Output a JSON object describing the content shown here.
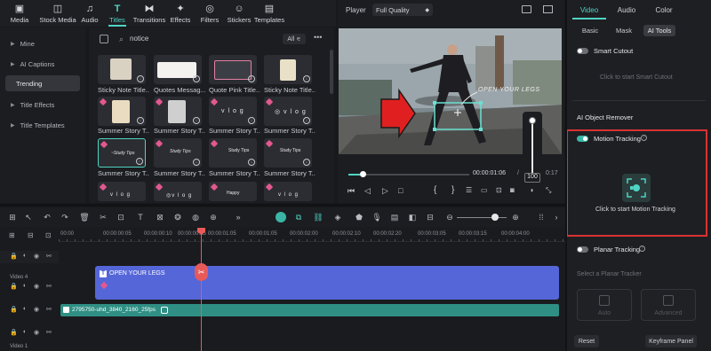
{
  "toolbar": {
    "items": [
      {
        "label": "Media",
        "icon": "media-icon"
      },
      {
        "label": "Stock Media",
        "icon": "stock-media-icon"
      },
      {
        "label": "Audio",
        "icon": "audio-icon"
      },
      {
        "label": "Titles",
        "icon": "titles-icon"
      },
      {
        "label": "Transitions",
        "icon": "transitions-icon"
      },
      {
        "label": "Effects",
        "icon": "effects-icon"
      },
      {
        "label": "Filters",
        "icon": "filters-icon"
      },
      {
        "label": "Stickers",
        "icon": "stickers-icon"
      },
      {
        "label": "Templates",
        "icon": "templates-icon"
      }
    ],
    "active": "Titles"
  },
  "categories": [
    {
      "label": "Mine",
      "selected": false
    },
    {
      "label": "AI Captions",
      "selected": false
    },
    {
      "label": "Trending",
      "selected": true
    },
    {
      "label": "Title Effects",
      "selected": false
    },
    {
      "label": "Title Templates",
      "selected": false
    }
  ],
  "search": {
    "value": "notice",
    "filter_label": "All"
  },
  "assets": [
    {
      "label": "Sticky Note Title..."
    },
    {
      "label": "Quotes Messag..."
    },
    {
      "label": "Quote Pink Title..."
    },
    {
      "label": "Sticky Note Title..."
    },
    {
      "label": "Summer Story T..."
    },
    {
      "label": "Summer Story T..."
    },
    {
      "label": "Summer Story T..."
    },
    {
      "label": "Summer Story T..."
    },
    {
      "label": "Summer Story T..."
    },
    {
      "label": "Summer Story T..."
    },
    {
      "label": "Summer Story T..."
    },
    {
      "label": "Summer Story T..."
    }
  ],
  "player": {
    "label": "Player",
    "quality": "Full Quality",
    "overlay_text": "OPEN YOUR LEGS",
    "timecode": "00:00:01:06",
    "duration_suffix": "0:17",
    "volume": "100",
    "progress": 0.12
  },
  "inspector": {
    "tabs": [
      "Video",
      "Audio",
      "Color"
    ],
    "active_tab": "Video",
    "subtabs": [
      "Basic",
      "Mask",
      "AI Tools"
    ],
    "active_subtab": "AI Tools",
    "smart_cutout": {
      "label": "Smart Cutout",
      "hint": "Click to start Smart Cutout"
    },
    "object_remover": "AI Object Remover",
    "motion_tracking": {
      "label": "Motion Tracking",
      "hint": "Click to start Motion Tracking",
      "enabled": true
    },
    "planar_tracking": {
      "label": "Planar Tracking",
      "select_hint": "Select a Planar Tracker",
      "auto": "Auto",
      "advanced": "Advanced"
    },
    "reset": "Reset",
    "keyframe_panel": "Keyframe Panel",
    "highlight_color": "#d93232"
  },
  "timeline": {
    "ruler": [
      "00:00",
      "00:00:00:05",
      "00:00:00:10",
      "00:00:00:15",
      "00:00:00:20",
      "00:00:01:05",
      "00:00:01:15",
      "00:00:02:00",
      "00:00:02:10",
      "00:00:02:20",
      "00:00:03:05",
      "00:00:03:15",
      "00:00:04:00"
    ],
    "title_clip": "OPEN YOUR LEGS",
    "video_clip": "2795750-uhd_3840_2160_25fps",
    "track_labels": [
      "Video 4",
      "Video 1"
    ]
  },
  "colors": {
    "accent": "#4fd4c4",
    "title_clip": "#5566d8",
    "video_clip": "#2f8f84"
  }
}
